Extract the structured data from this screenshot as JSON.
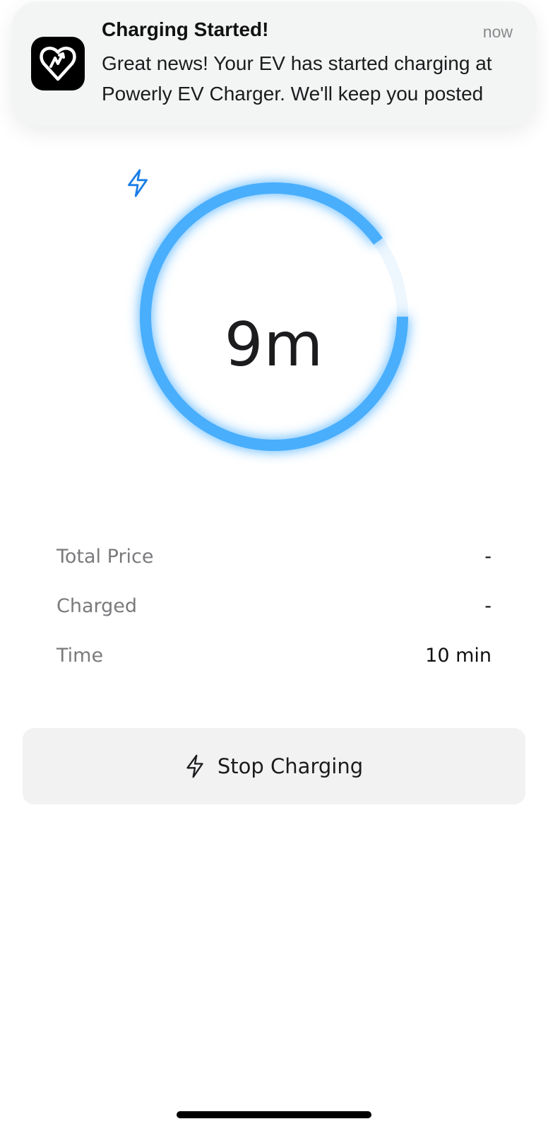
{
  "notification": {
    "title": "Charging Started!",
    "time": "now",
    "body": "Great news! Your EV has started charging at Powerly EV Charger. We'll keep you posted",
    "app_icon": "powerly-logo-icon"
  },
  "charging": {
    "time_remaining": "9m",
    "progress_fraction": 0.9,
    "accent_color": "#4aaefc",
    "icon": "lightning-bolt-icon"
  },
  "stats": [
    {
      "label": "Total Price",
      "value": "-"
    },
    {
      "label": "Charged",
      "value": "-"
    },
    {
      "label": "Time",
      "value": "10 min"
    }
  ],
  "actions": {
    "stop_label": "Stop Charging",
    "stop_icon": "lightning-bolt-icon"
  }
}
